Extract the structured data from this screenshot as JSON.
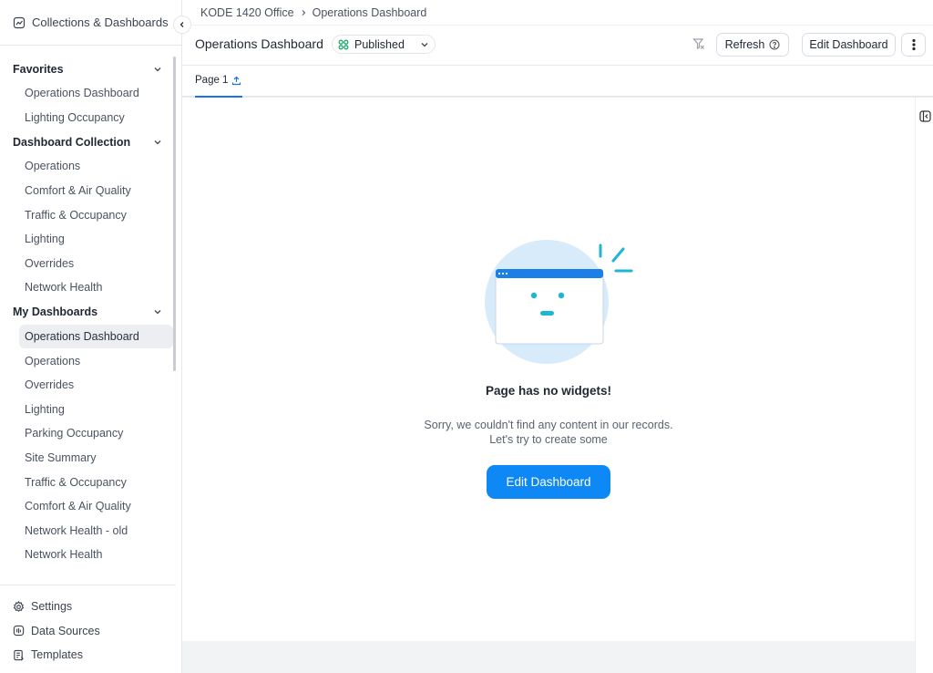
{
  "sidebar": {
    "header": "Collections & Dashboards",
    "sections": [
      {
        "title": "Favorites",
        "items": [
          "Operations Dashboard",
          "Lighting Occupancy"
        ]
      },
      {
        "title": "Dashboard Collection",
        "items": [
          "Operations",
          "Comfort & Air Quality",
          "Traffic & Occupancy",
          "Lighting",
          "Overrides",
          "Network Health"
        ]
      },
      {
        "title": "My Dashboards",
        "items": [
          "Operations Dashboard",
          "Operations",
          "Overrides",
          "Lighting",
          "Parking Occupancy",
          "Site Summary",
          "Traffic & Occupancy",
          "Comfort & Air Quality",
          "Network Health - old",
          "Network Health"
        ]
      }
    ],
    "bottom": [
      "Settings",
      "Data Sources",
      "Templates"
    ]
  },
  "breadcrumb": {
    "parent": "KODE 1420 Office",
    "current": "Operations Dashboard"
  },
  "header": {
    "title": "Operations Dashboard",
    "status": "Published",
    "refresh_label": "Refresh",
    "edit_label": "Edit Dashboard"
  },
  "tabs": [
    {
      "label": "Page 1"
    }
  ],
  "empty_state": {
    "title": "Page has no widgets!",
    "line1": "Sorry, we couldn't find any content in our records.",
    "line2": "Let's try to create some",
    "cta_label": "Edit Dashboard"
  },
  "colors": {
    "accent": "#0e88f5",
    "published": "#1aa86b",
    "illustration_bg": "#d8ebfb",
    "illustration_eyes": "#1fb6d6"
  }
}
